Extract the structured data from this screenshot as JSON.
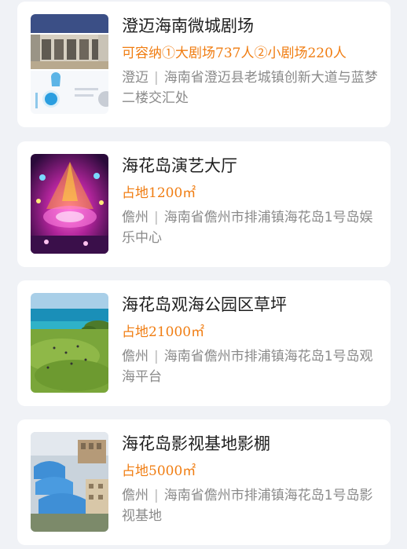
{
  "venues": [
    {
      "title": "澄迈海南微城剧场",
      "capacity": "可容纳①大剧场737人②小剧场220人",
      "city": "澄迈",
      "separator": "|",
      "address": "海南省澄迈县老城镇创新大道与蓝梦二楼交汇处",
      "image_icon": "theater-interior-photo"
    },
    {
      "title": "海花岛演艺大厅",
      "capacity": "占地1200㎡",
      "city": "儋州",
      "separator": "|",
      "address": "海南省儋州市排浦镇海花岛1号岛娱乐中心",
      "image_icon": "stage-lights-photo"
    },
    {
      "title": "海花岛观海公园区草坪",
      "capacity": "占地21000㎡",
      "city": "儋州",
      "separator": "|",
      "address": "海南省儋州市排浦镇海花岛1号岛观海平台",
      "image_icon": "seaside-lawn-photo"
    },
    {
      "title": "海花岛影视基地影棚",
      "capacity": "占地5000㎡",
      "city": "儋州",
      "separator": "|",
      "address": "海南省儋州市排浦镇海花岛1号岛影视基地",
      "image_icon": "film-studio-aerial-photo"
    }
  ],
  "colors": {
    "background": "#f0f2f6",
    "card": "#ffffff",
    "title": "#1f1f1f",
    "capacity": "#f07d12",
    "address": "#8a8a8a"
  }
}
